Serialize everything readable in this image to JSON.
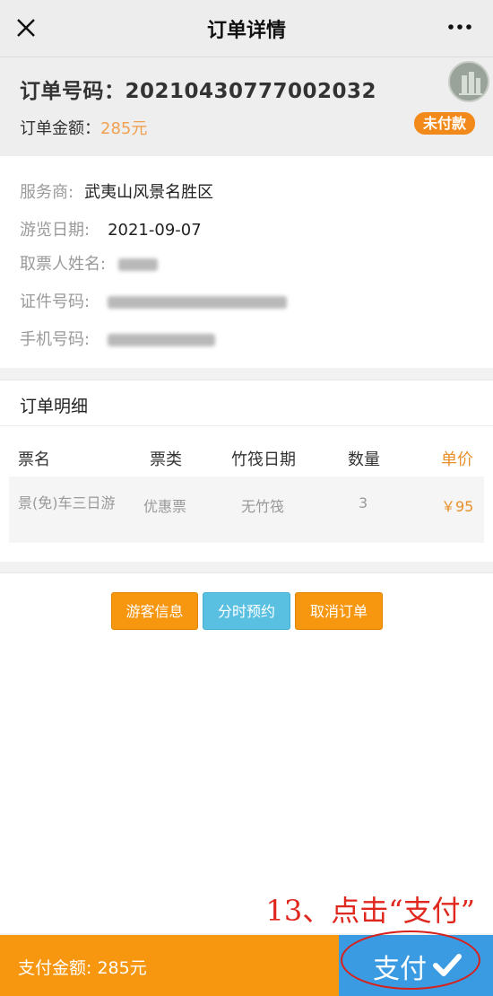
{
  "topbar": {
    "title": "订单详情",
    "close_icon": "close-icon",
    "more_icon": "more-icon"
  },
  "order": {
    "number_label": "订单号码：",
    "number": "20210430777002032",
    "amount_label": "订单金额：",
    "amount": "285元",
    "status": "未付款"
  },
  "info": {
    "provider_label": "服务商:",
    "provider": "武夷山风景名胜区",
    "date_label": "游览日期:",
    "date": "2021-09-07",
    "name_label": "取票人姓名:",
    "id_label": "证件号码:",
    "phone_label": "手机号码:"
  },
  "detail": {
    "title": "订单明细",
    "columns": [
      "票名",
      "票类",
      "竹筏日期",
      "数量",
      "单价"
    ],
    "rows": [
      [
        "景(免)车三日游",
        "优惠票",
        "无竹筏",
        "3",
        "￥95"
      ]
    ]
  },
  "actions": {
    "visitor_info": "游客信息",
    "time_booking": "分时预约",
    "cancel_order": "取消订单"
  },
  "annotation": "13、点击“支付”",
  "paybar": {
    "amount_text": "支付金额: 285元",
    "pay_label": "支付"
  },
  "colors": {
    "accent_orange": "#f7960f",
    "accent_blue": "#3b9be2",
    "annotation_red": "#e0271d"
  }
}
